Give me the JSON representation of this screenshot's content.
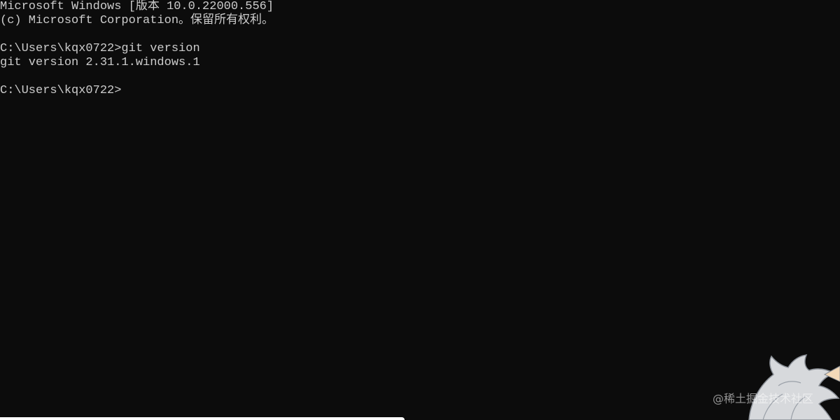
{
  "console": {
    "lines": [
      "Microsoft Windows [版本 10.0.22000.556]",
      "(c) Microsoft Corporation。保留所有权利。",
      "",
      "C:\\Users\\kqx0722>git version",
      "git version 2.31.1.windows.1",
      "",
      "C:\\Users\\kqx0722>"
    ]
  },
  "colors": {
    "background": "#0c0c0c",
    "text": "#cccccc"
  },
  "overlay": {
    "watermark": "@稀土掘金技术社区",
    "mascot_icon": "anime-mascot-icon"
  }
}
